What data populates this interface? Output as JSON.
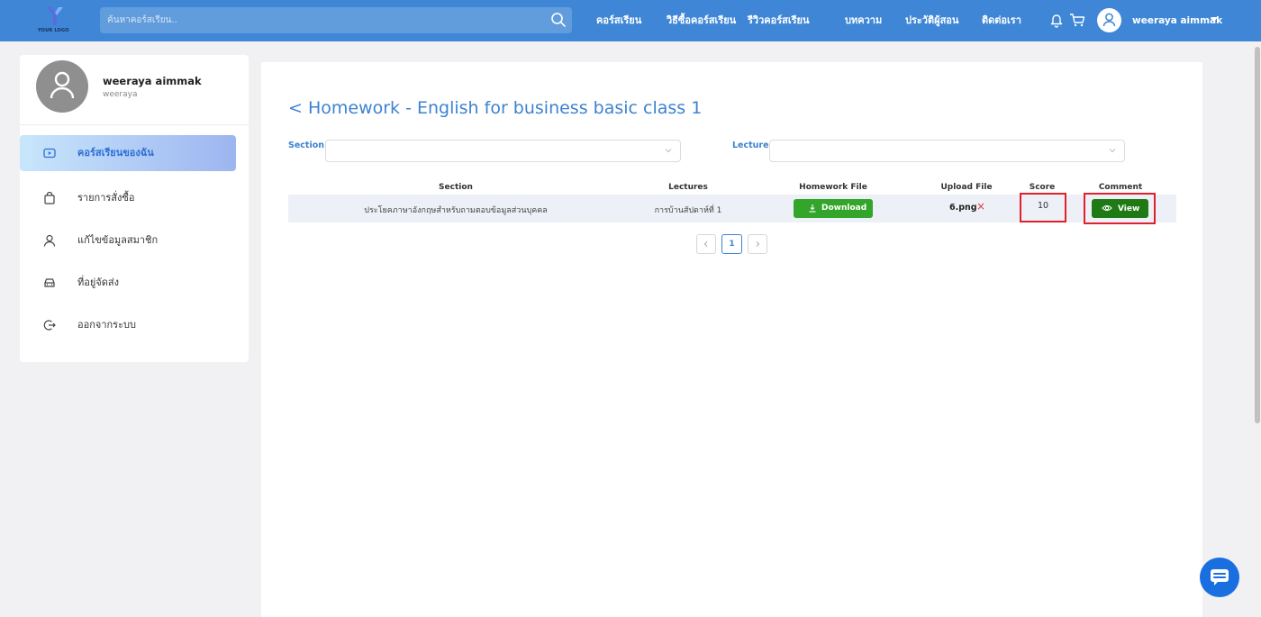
{
  "header": {
    "logo_text": "YOUR LOGO",
    "search": {
      "placeholder": "ค้นหาคอร์สเรียน..",
      "value": ""
    },
    "nav": [
      {
        "label": "คอร์สเรียน"
      },
      {
        "label": "วิธีซื้อคอร์สเรียน"
      },
      {
        "label": "รีวิวคอร์สเรียน"
      },
      {
        "label": "บทความ"
      },
      {
        "label": "ประวัติผู้สอน"
      },
      {
        "label": "ติดต่อเรา"
      }
    ],
    "icons": [
      "bell-icon",
      "cart-icon",
      "user-icon",
      "caret-down-icon"
    ],
    "user_name": "weeraya aimmak"
  },
  "sidebar": {
    "name": "weeraya aimmak",
    "username": "weeraya",
    "items": [
      {
        "label": "คอร์สเรียนของฉัน",
        "icon": "play-icon",
        "active": true
      },
      {
        "label": "รายการสั่งซื้อ",
        "icon": "shopping-bag-icon",
        "active": false
      },
      {
        "label": "แก้ไขข้อมูลสมาชิก",
        "icon": "user-icon",
        "active": false
      },
      {
        "label": "ที่อยู่จัดส่ง",
        "icon": "car-icon",
        "active": false
      },
      {
        "label": "ออกจากระบบ",
        "icon": "logout-icon",
        "active": false
      }
    ]
  },
  "main": {
    "title": "< Homework - English for business basic class 1",
    "filters": {
      "section_label": "Section",
      "section_value": "",
      "lecture_label": "Lecture",
      "lecture_value": ""
    },
    "table": {
      "headers": [
        "Section",
        "Lectures",
        "Homework File",
        "Upload File",
        "Score",
        "Comment"
      ],
      "rows": [
        {
          "section": "ประโยคภาษาอังกฤษสำหรับถามตอบข้อมูลส่วนบุคคล",
          "lecture": "การบ้านสัปดาห์ที่ 1",
          "homework_button": "Download",
          "upload_file": "6.png",
          "remove_mark": "×",
          "score": "10",
          "comment_button": "View"
        }
      ]
    },
    "pagination": {
      "current": "1"
    }
  },
  "colors": {
    "header_bg": "#3f87d6",
    "accent": "#3d82d1",
    "download_green": "#34a52b",
    "view_green": "#1f7a16",
    "highlight_red": "#e0202a"
  }
}
